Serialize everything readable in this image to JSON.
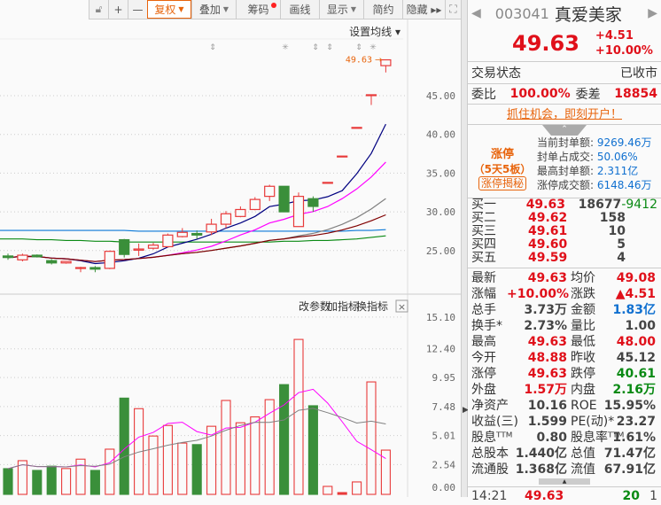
{
  "toolbar": {
    "items": [
      {
        "label": "",
        "icon": "unlock-icon"
      },
      {
        "label": "+"
      },
      {
        "label": "—"
      },
      {
        "label": "复权",
        "active": true,
        "caret": true
      },
      {
        "label": "叠加",
        "caret": true
      },
      {
        "label": "筹码",
        "dot": true
      },
      {
        "label": "画线"
      },
      {
        "label": "显示",
        "caret": true
      },
      {
        "label": "简约"
      },
      {
        "label": "隐藏 ▸▸"
      },
      {
        "label": "",
        "icon": "fullscreen-icon"
      }
    ]
  },
  "price_chart": {
    "ma_setting_label": "设置均线 ▾",
    "last_price_label": "49.63",
    "y_ticks": [
      "45.00",
      "40.00",
      "35.00",
      "30.00",
      "25.00"
    ],
    "candles": [
      [
        24.3,
        24.6,
        23.8,
        24.1
      ],
      [
        23.8,
        24.6,
        23.6,
        24.4
      ],
      [
        24.4,
        24.5,
        24.1,
        24.2
      ],
      [
        23.7,
        23.9,
        23.2,
        23.4
      ],
      [
        23.4,
        23.6,
        23.3,
        23.6
      ],
      [
        22.7,
        22.9,
        22.2,
        22.8
      ],
      [
        22.8,
        23.0,
        22.2,
        22.6
      ],
      [
        22.7,
        25.0,
        22.6,
        24.9
      ],
      [
        26.4,
        26.5,
        24.1,
        24.5
      ],
      [
        25.05,
        25.9,
        24.3,
        25.2
      ],
      [
        25.3,
        26.0,
        25.1,
        25.7
      ],
      [
        25.5,
        27.2,
        25.4,
        27.0
      ],
      [
        26.8,
        27.9,
        26.7,
        27.35
      ],
      [
        27.2,
        27.6,
        26.5,
        27.0
      ],
      [
        27.4,
        29.1,
        27.0,
        28.4
      ],
      [
        28.4,
        30.1,
        27.9,
        29.75
      ],
      [
        29.4,
        30.7,
        29.3,
        30.3
      ],
      [
        30.3,
        31.9,
        30.2,
        31.6
      ],
      [
        32.0,
        33.5,
        31.4,
        33.3
      ],
      [
        33.3,
        33.3,
        30.0,
        30.0
      ],
      [
        28.1,
        32.5,
        28.1,
        32.0
      ],
      [
        31.7,
        32.0,
        30.0,
        30.7
      ],
      [
        33.75,
        33.8,
        33.7,
        33.8
      ],
      [
        37.15,
        37.2,
        37.1,
        37.2
      ],
      [
        40.85,
        40.9,
        40.8,
        40.9
      ],
      [
        45.1,
        45.12,
        43.8,
        45.12
      ],
      [
        48.88,
        49.63,
        48.0,
        49.63
      ]
    ],
    "ma_lines": [
      {
        "name": "MA5",
        "period": 5,
        "color": "#000080"
      },
      {
        "name": "MA10",
        "period": 10,
        "color": "#ff00ff"
      },
      {
        "name": "MA20",
        "period": 20,
        "color": "#808080"
      },
      {
        "name": "MA30",
        "period": 30,
        "color": "#800000"
      }
    ],
    "flat_lines": [
      {
        "color": "#0a78d8",
        "values": [
          27.6,
          27.6,
          27.6,
          27.6,
          27.6,
          27.6,
          27.6,
          27.6,
          27.6,
          27.5,
          27.5,
          27.5,
          27.5,
          27.5,
          27.5,
          27.5,
          27.5,
          27.5,
          27.5,
          27.5,
          27.5,
          27.5,
          27.5,
          27.5,
          27.6,
          27.6,
          27.7
        ]
      },
      {
        "color": "#0a8a14",
        "values": [
          26.5,
          26.5,
          26.4,
          26.4,
          26.3,
          26.3,
          26.2,
          26.2,
          26.1,
          26.1,
          26.1,
          26.1,
          26.1,
          26.1,
          26.1,
          26.1,
          26.1,
          26.1,
          26.1,
          26.2,
          26.2,
          26.3,
          26.3,
          26.4,
          26.5,
          26.7,
          26.9
        ]
      }
    ],
    "markers": [
      "⇕",
      "✳",
      "⇕",
      "⇕",
      "⇕",
      "✳"
    ]
  },
  "volume_chart": {
    "buttons": [
      "改参数",
      "加指标",
      "换指标"
    ],
    "close_label": "×",
    "y_ticks": [
      "15.10",
      "12.40",
      "9.95",
      "7.48",
      "5.01",
      "2.54",
      "0.00"
    ],
    "y_max": 15.1,
    "values": [
      2.19,
      2.87,
      2.04,
      2.4,
      2.2,
      3.0,
      2.04,
      3.85,
      8.2,
      7.3,
      4.97,
      5.87,
      4.37,
      4.24,
      5.8,
      8.0,
      6.1,
      6.6,
      8.07,
      9.35,
      13.2,
      7.55,
      0.68,
      0.15,
      1.06,
      9.58,
      3.77
    ]
  },
  "colors": {
    "up": "#e83a3a",
    "down": "#3a8f3a"
  },
  "quote": {
    "code": "003041",
    "name": "真爱美家",
    "price": "49.63",
    "change": "+4.51",
    "change_pct": "+10.00%"
  },
  "status": {
    "label": "交易状态",
    "value": "已收市"
  },
  "wei": {
    "ratio_label": "委比",
    "ratio": "100.00%",
    "diff_label": "委差",
    "diff": "18854"
  },
  "promo": "抓住机会，即刻开户！",
  "limit": {
    "title": "涨停",
    "streak": "（5天5板）",
    "reveal_btn": "涨停揭秘",
    "rows": [
      {
        "label": "当前封单额:",
        "value": "9269.46万"
      },
      {
        "label": "封单占成交:",
        "value": "50.06%"
      },
      {
        "label": "最高封单额:",
        "value": "2.311亿"
      },
      {
        "label": "涨停成交额:",
        "value": "6148.46万"
      }
    ]
  },
  "bids": [
    {
      "label": "买一",
      "price": "49.63",
      "vol": "18677",
      "chg": "-9412"
    },
    {
      "label": "买二",
      "price": "49.62",
      "vol": "158",
      "chg": ""
    },
    {
      "label": "买三",
      "price": "49.61",
      "vol": "10",
      "chg": ""
    },
    {
      "label": "买四",
      "price": "49.60",
      "vol": "5",
      "chg": ""
    },
    {
      "label": "买五",
      "price": "49.59",
      "vol": "4",
      "chg": ""
    }
  ],
  "stats": [
    [
      "最新",
      "49.63",
      "red",
      "均价",
      "49.08",
      "red"
    ],
    [
      "涨幅",
      "+10.00%",
      "red",
      "涨跌",
      "▲4.51",
      "red"
    ],
    [
      "总手",
      "3.73万",
      "gray",
      "金额",
      "1.83亿",
      "blue"
    ],
    [
      "换手*",
      "2.73%",
      "gray",
      "量比",
      "1.00",
      "gray"
    ],
    [
      "最高",
      "49.63",
      "red",
      "最低",
      "48.00",
      "red"
    ],
    [
      "今开",
      "48.88",
      "red",
      "昨收",
      "45.12",
      "gray"
    ],
    [
      "涨停",
      "49.63",
      "red",
      "跌停",
      "40.61",
      "green"
    ],
    [
      "外盘",
      "1.57万",
      "red",
      "内盘",
      "2.16万",
      "green"
    ],
    [
      "净资产",
      "10.16",
      "gray",
      "ROE",
      "15.95%",
      "gray"
    ],
    [
      "收益(三)",
      "1.599",
      "gray",
      "PE(动)*",
      "23.27",
      "gray"
    ],
    [
      "股息ᵀᵀᴹ",
      "0.80",
      "gray",
      "股息率ᵀᵀᴹ",
      "1.61%",
      "gray"
    ],
    [
      "总股本",
      "1.440亿",
      "gray",
      "总值",
      "71.47亿",
      "gray"
    ],
    [
      "流通股",
      "1.368亿",
      "gray",
      "流值",
      "67.91亿",
      "gray"
    ]
  ],
  "tick": {
    "time": "14:21",
    "price": "49.63",
    "vol": "20",
    "count": "1"
  }
}
